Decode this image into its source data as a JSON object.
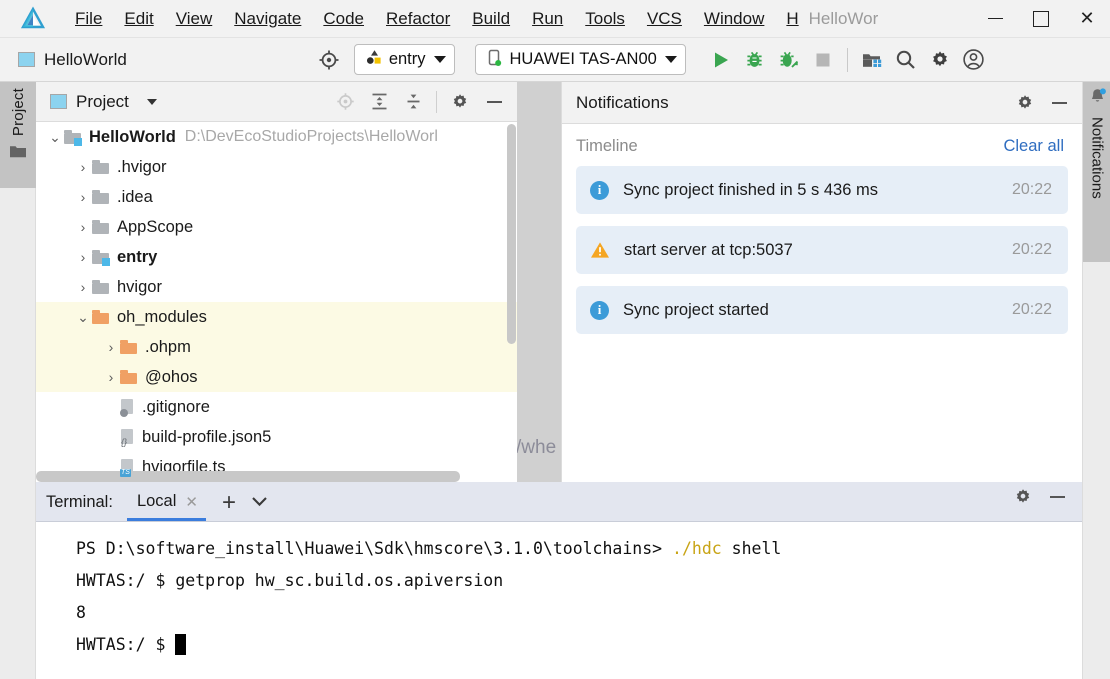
{
  "menu": {
    "logo_icon": "deveco-studio-logo",
    "items": [
      {
        "label": "File",
        "mnemonic": "F"
      },
      {
        "label": "Edit",
        "mnemonic": "E"
      },
      {
        "label": "View",
        "mnemonic": "V"
      },
      {
        "label": "Navigate",
        "mnemonic": "N"
      },
      {
        "label": "Code",
        "mnemonic": "C"
      },
      {
        "label": "Refactor",
        "mnemonic": "R"
      },
      {
        "label": "Build",
        "mnemonic": "B"
      },
      {
        "label": "Run",
        "mnemonic": "u"
      },
      {
        "label": "Tools",
        "mnemonic": "T"
      },
      {
        "label": "VCS",
        "mnemonic": "S"
      },
      {
        "label": "Window",
        "mnemonic": "W"
      },
      {
        "label": "H",
        "mnemonic": "H"
      }
    ],
    "window_title": "HelloWor",
    "controls": {
      "minimize": "minimize-icon",
      "maximize": "maximize-icon",
      "close": "✕"
    }
  },
  "toolbar": {
    "project_name": "HelloWorld",
    "project_icon": "project-module-icon",
    "target_icon": "select-opened-file-icon",
    "run_config": "entry",
    "run_config_icon": "module-entry-icon",
    "device": "HUAWEI TAS-AN00",
    "device_icon": "phone-connected-icon",
    "actions": [
      {
        "name": "run-button",
        "icon": "play-triangle"
      },
      {
        "name": "debug-button",
        "icon": "bug"
      },
      {
        "name": "attach-debugger-button",
        "icon": "bug-attach"
      },
      {
        "name": "stop-button",
        "icon": "stop-square"
      },
      {
        "name": "device-manager-button",
        "icon": "device-manager"
      },
      {
        "name": "search-everywhere-button",
        "icon": "magnifier"
      },
      {
        "name": "settings-button",
        "icon": "gear"
      },
      {
        "name": "account-button",
        "icon": "user-avatar"
      }
    ]
  },
  "left_strip": {
    "project_tab": "Project",
    "project_tab_icon": "folder-icon"
  },
  "right_strip": {
    "notifications_tab": "Notifications",
    "notifications_tab_icon": "bell-icon"
  },
  "editor": {
    "backdrop_text": "/whe"
  },
  "project_panel": {
    "title": "Project",
    "title_icon": "project-view-icon",
    "tools": [
      {
        "name": "select-opened-file-button",
        "icon": "crosshair-target"
      },
      {
        "name": "expand-all-button",
        "icon": "expand-all"
      },
      {
        "name": "collapse-all-button",
        "icon": "collapse-all"
      },
      {
        "name": "panel-settings-button",
        "icon": "gear"
      },
      {
        "name": "hide-panel-button",
        "icon": "minus"
      }
    ],
    "tree": [
      {
        "label": "HelloWorld",
        "path": "D:\\DevEcoStudioProjects\\HelloWorl",
        "depth": 0,
        "expanded": true,
        "kind": "folder-module",
        "bold": true,
        "highlight": false
      },
      {
        "label": ".hvigor",
        "depth": 1,
        "expanded": false,
        "kind": "folder",
        "bold": false,
        "highlight": false
      },
      {
        "label": ".idea",
        "depth": 1,
        "expanded": false,
        "kind": "folder",
        "bold": false,
        "highlight": false
      },
      {
        "label": "AppScope",
        "depth": 1,
        "expanded": false,
        "kind": "folder",
        "bold": false,
        "highlight": false
      },
      {
        "label": "entry",
        "depth": 1,
        "expanded": false,
        "kind": "folder-module",
        "bold": true,
        "highlight": false
      },
      {
        "label": "hvigor",
        "depth": 1,
        "expanded": false,
        "kind": "folder",
        "bold": false,
        "highlight": false
      },
      {
        "label": "oh_modules",
        "depth": 1,
        "expanded": true,
        "kind": "folder-orange",
        "bold": false,
        "highlight": true
      },
      {
        "label": ".ohpm",
        "depth": 2,
        "expanded": false,
        "kind": "folder-orange",
        "bold": false,
        "highlight": true
      },
      {
        "label": "@ohos",
        "depth": 2,
        "expanded": false,
        "kind": "folder-orange",
        "bold": false,
        "highlight": true
      },
      {
        "label": ".gitignore",
        "depth": 2,
        "kind": "file",
        "filetag": "ignore",
        "bold": false,
        "highlight": false
      },
      {
        "label": "build-profile.json5",
        "depth": 2,
        "kind": "file",
        "filetag": "json",
        "bold": false,
        "highlight": false
      },
      {
        "label": "hvigorfile.ts",
        "depth": 2,
        "kind": "file",
        "filetag": "TS",
        "bold": false,
        "highlight": false
      }
    ]
  },
  "notifications_panel": {
    "title": "Notifications",
    "tools": [
      {
        "name": "notifications-settings-button",
        "icon": "gear"
      },
      {
        "name": "hide-notifications-button",
        "icon": "minus"
      }
    ],
    "section_label": "Timeline",
    "clear_all": "Clear all",
    "items": [
      {
        "severity": "info",
        "icon": "info-icon",
        "message": "Sync project finished in 5 s 436 ms",
        "time": "20:22"
      },
      {
        "severity": "warning",
        "icon": "warning-icon",
        "message": "start server at tcp:5037",
        "time": "20:22"
      },
      {
        "severity": "info",
        "icon": "info-icon",
        "message": "Sync project started",
        "time": "20:22"
      }
    ]
  },
  "terminal": {
    "label": "Terminal:",
    "tab": "Local",
    "tab_close": "✕",
    "add_tab": "+",
    "tools": [
      {
        "name": "terminal-settings-button",
        "icon": "gear"
      },
      {
        "name": "hide-terminal-button",
        "icon": "minus"
      }
    ],
    "lines": [
      {
        "prefix": "PS D:\\software_install\\Huawei\\Sdk\\hmscore\\3.1.0\\toolchains> ",
        "cmd": "./hdc",
        "suffix": " shell"
      },
      {
        "prefix": "HWTAS:/ $ getprop hw_sc.build.os.apiversion",
        "cmd": "",
        "suffix": ""
      },
      {
        "prefix": "8",
        "cmd": "",
        "suffix": ""
      },
      {
        "prefix": "HWTAS:/ $ ",
        "cmd": "",
        "suffix": "",
        "cursor": true
      }
    ]
  },
  "colors": {
    "accent_blue": "#3b7ddd",
    "link_blue": "#2f6dc0",
    "notif_row_bg": "#e6eef7",
    "highlight_yellow": "#fcfae4",
    "folder_orange": "#f0a064",
    "run_green": "#3aa550",
    "terminal_yellow": "#c8a415"
  }
}
